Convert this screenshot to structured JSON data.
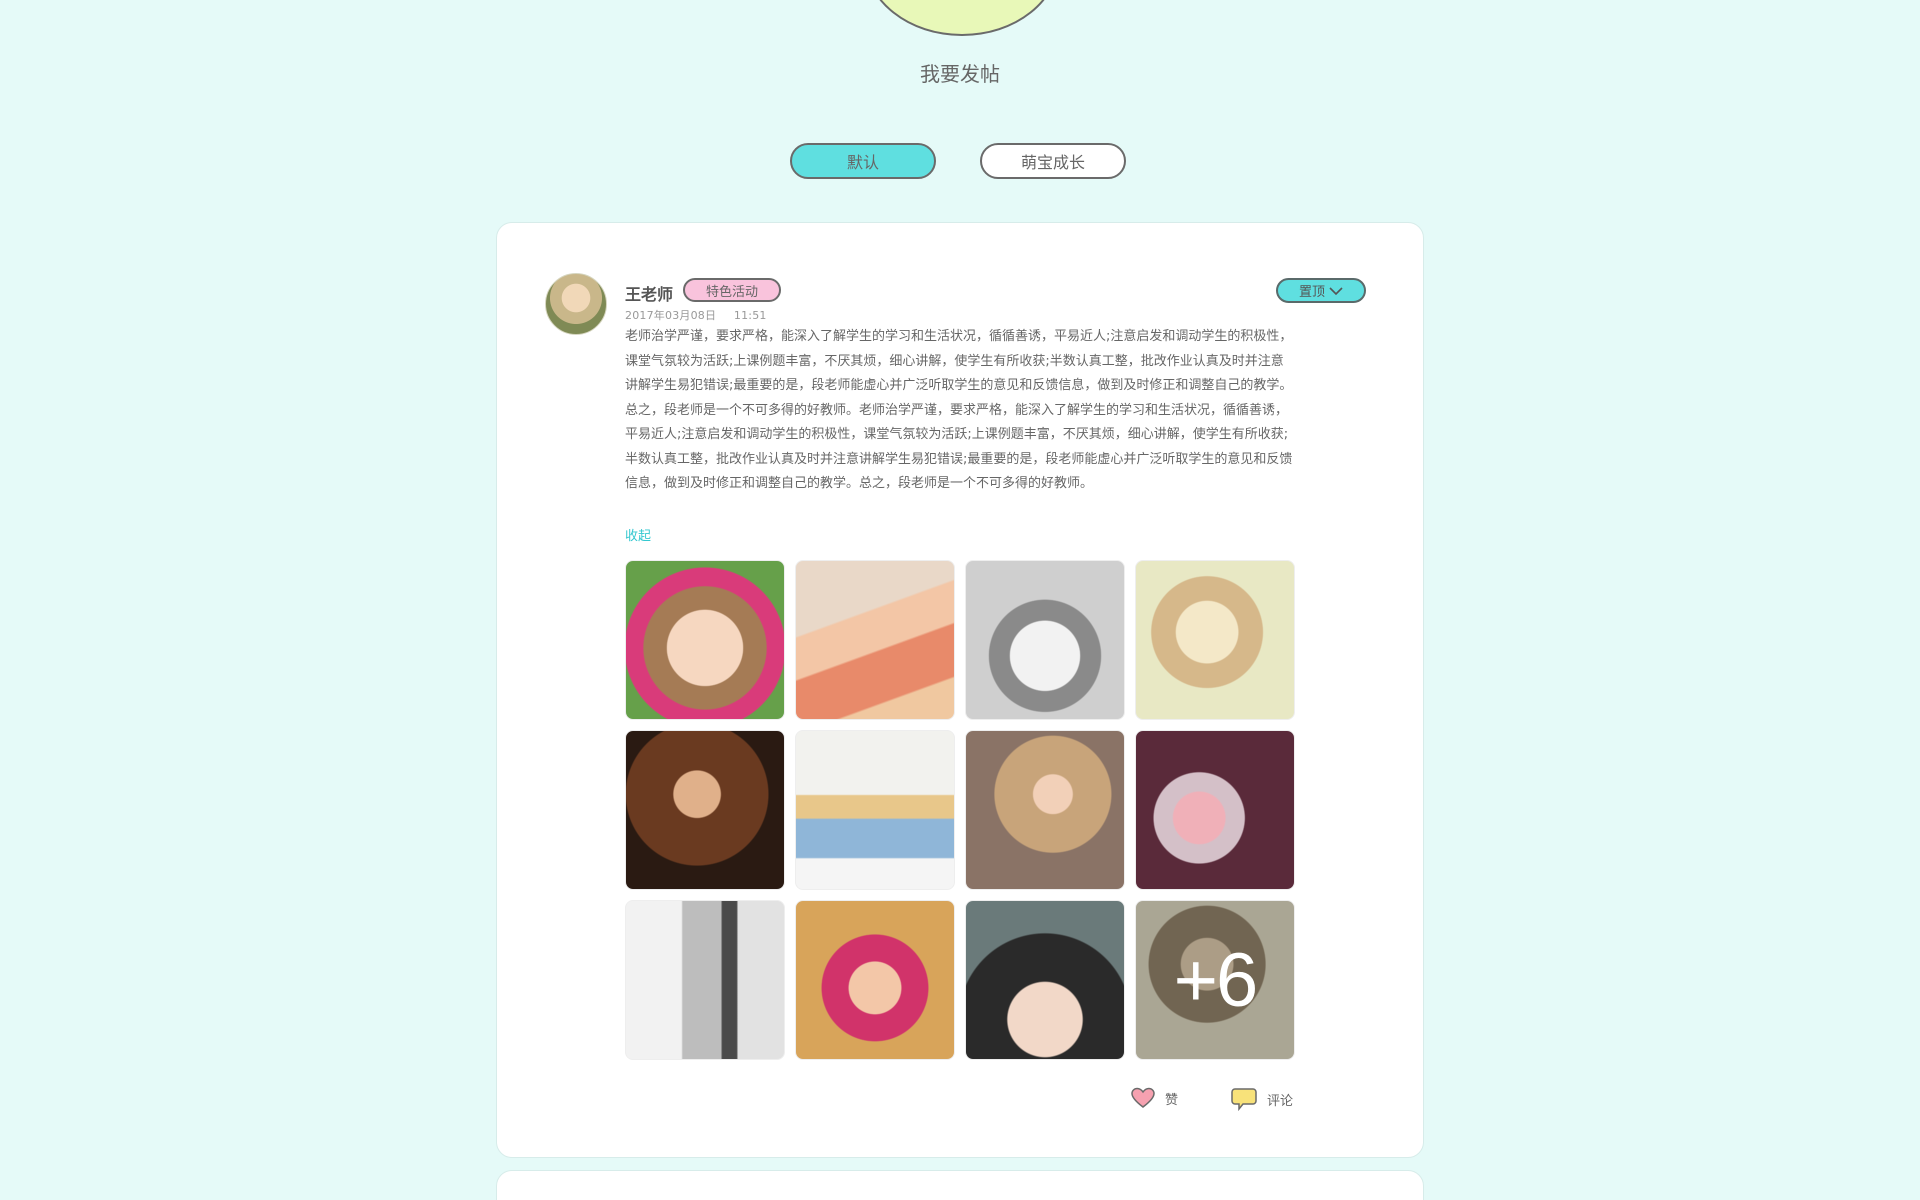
{
  "header": {
    "post_button_label": "我要发帖"
  },
  "tabs": [
    {
      "label": "默认",
      "active": true
    },
    {
      "label": "萌宝成长",
      "active": false
    }
  ],
  "post": {
    "author": "王老师",
    "badge": "特色活动",
    "pin_label": "置顶",
    "date": "2017年03月08日",
    "time": "11:51",
    "body": "老师治学严谨，要求严格，能深入了解学生的学习和生活状况，循循善诱，平易近人;注意启发和调动学生的积极性，课堂气氛较为活跃;上课例题丰富，不厌其烦，细心讲解，使学生有所收获;半数认真工整，批改作业认真及时并注意讲解学生易犯错误;最重要的是，段老师能虚心并广泛听取学生的意见和反馈信息，做到及时修正和调整自己的教学。总之，段老师是一个不可多得的好教师。老师治学严谨，要求严格，能深入了解学生的学习和生活状况，循循善诱，平易近人;注意启发和调动学生的积极性，课堂气氛较为活跃;上课例题丰富，不厌其烦，细心讲解，使学生有所收获;半数认真工整，批改作业认真及时并注意讲解学生易犯错误;最重要的是，段老师能虚心并广泛听取学生的意见和反馈信息，做到及时修正和调整自己的教学。总之，段老师是一个不可多得的好教师。",
    "collapse_label": "收起",
    "more_photos": "+6",
    "like_label": "赞",
    "comment_label": "评论"
  },
  "colors": {
    "background": "#e5faf8",
    "accent_teal": "#5fdfe0",
    "badge_pink": "#f9c3dc",
    "link_teal": "#35c8d0",
    "like_heart": "#f6a1b0",
    "comment_yellow": "#f8e27a"
  },
  "icons": [
    "heart-icon",
    "comment-bubble-icon",
    "chevron-down-icon"
  ]
}
